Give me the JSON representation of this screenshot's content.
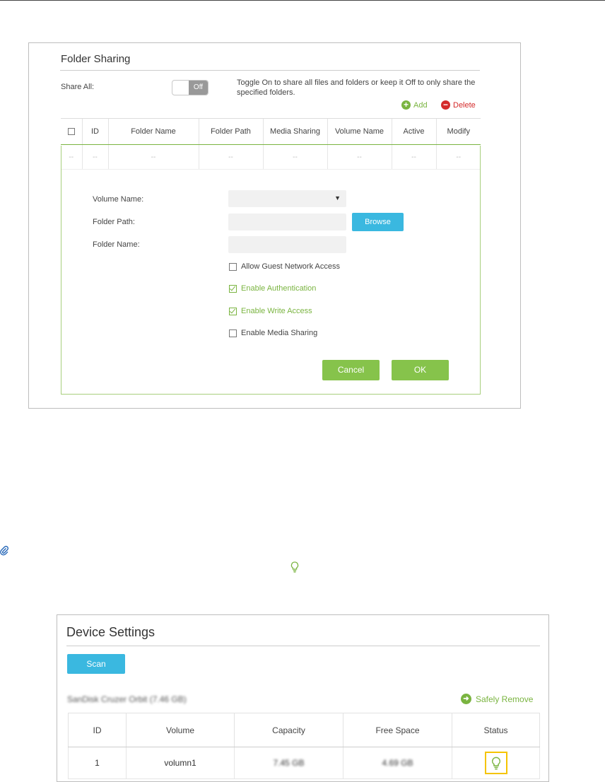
{
  "folder_sharing": {
    "title": "Folder Sharing",
    "share_all_label": "Share All:",
    "toggle_state": "Off",
    "share_all_description": "Toggle On to share all files and folders or keep it Off to only share the specified folders.",
    "add_label": "Add",
    "delete_label": "Delete",
    "columns": [
      "ID",
      "Folder Name",
      "Folder Path",
      "Media Sharing",
      "Volume Name",
      "Active",
      "Modify"
    ],
    "empty_row": [
      "--",
      "--",
      "--",
      "--",
      "--",
      "--",
      "--",
      "--"
    ],
    "form": {
      "volume_name_label": "Volume Name:",
      "folder_path_label": "Folder Path:",
      "folder_name_label": "Folder Name:",
      "browse_label": "Browse",
      "allow_guest_label": "Allow Guest Network Access",
      "enable_auth_label": "Enable Authentication",
      "enable_write_label": "Enable Write Access",
      "enable_media_label": "Enable Media Sharing",
      "allow_guest_checked": false,
      "enable_auth_checked": true,
      "enable_write_checked": true,
      "enable_media_checked": false,
      "cancel_label": "Cancel",
      "ok_label": "OK"
    }
  },
  "device_settings": {
    "title": "Device Settings",
    "scan_label": "Scan",
    "drive_label": "SanDisk   Cruzer Orbit (7.46 GB)",
    "safely_remove_label": "Safely Remove",
    "columns": [
      "ID",
      "Volume",
      "Capacity",
      "Free Space",
      "Status"
    ],
    "rows": [
      {
        "id": "1",
        "volume": "volumn1",
        "capacity": "7.45 GB",
        "free_space": "4.69 GB"
      }
    ]
  },
  "colors": {
    "accent_green": "#7ab440",
    "accent_blue": "#3ab8e0",
    "delete_red": "#d42a2a",
    "status_highlight": "#f5c400"
  }
}
